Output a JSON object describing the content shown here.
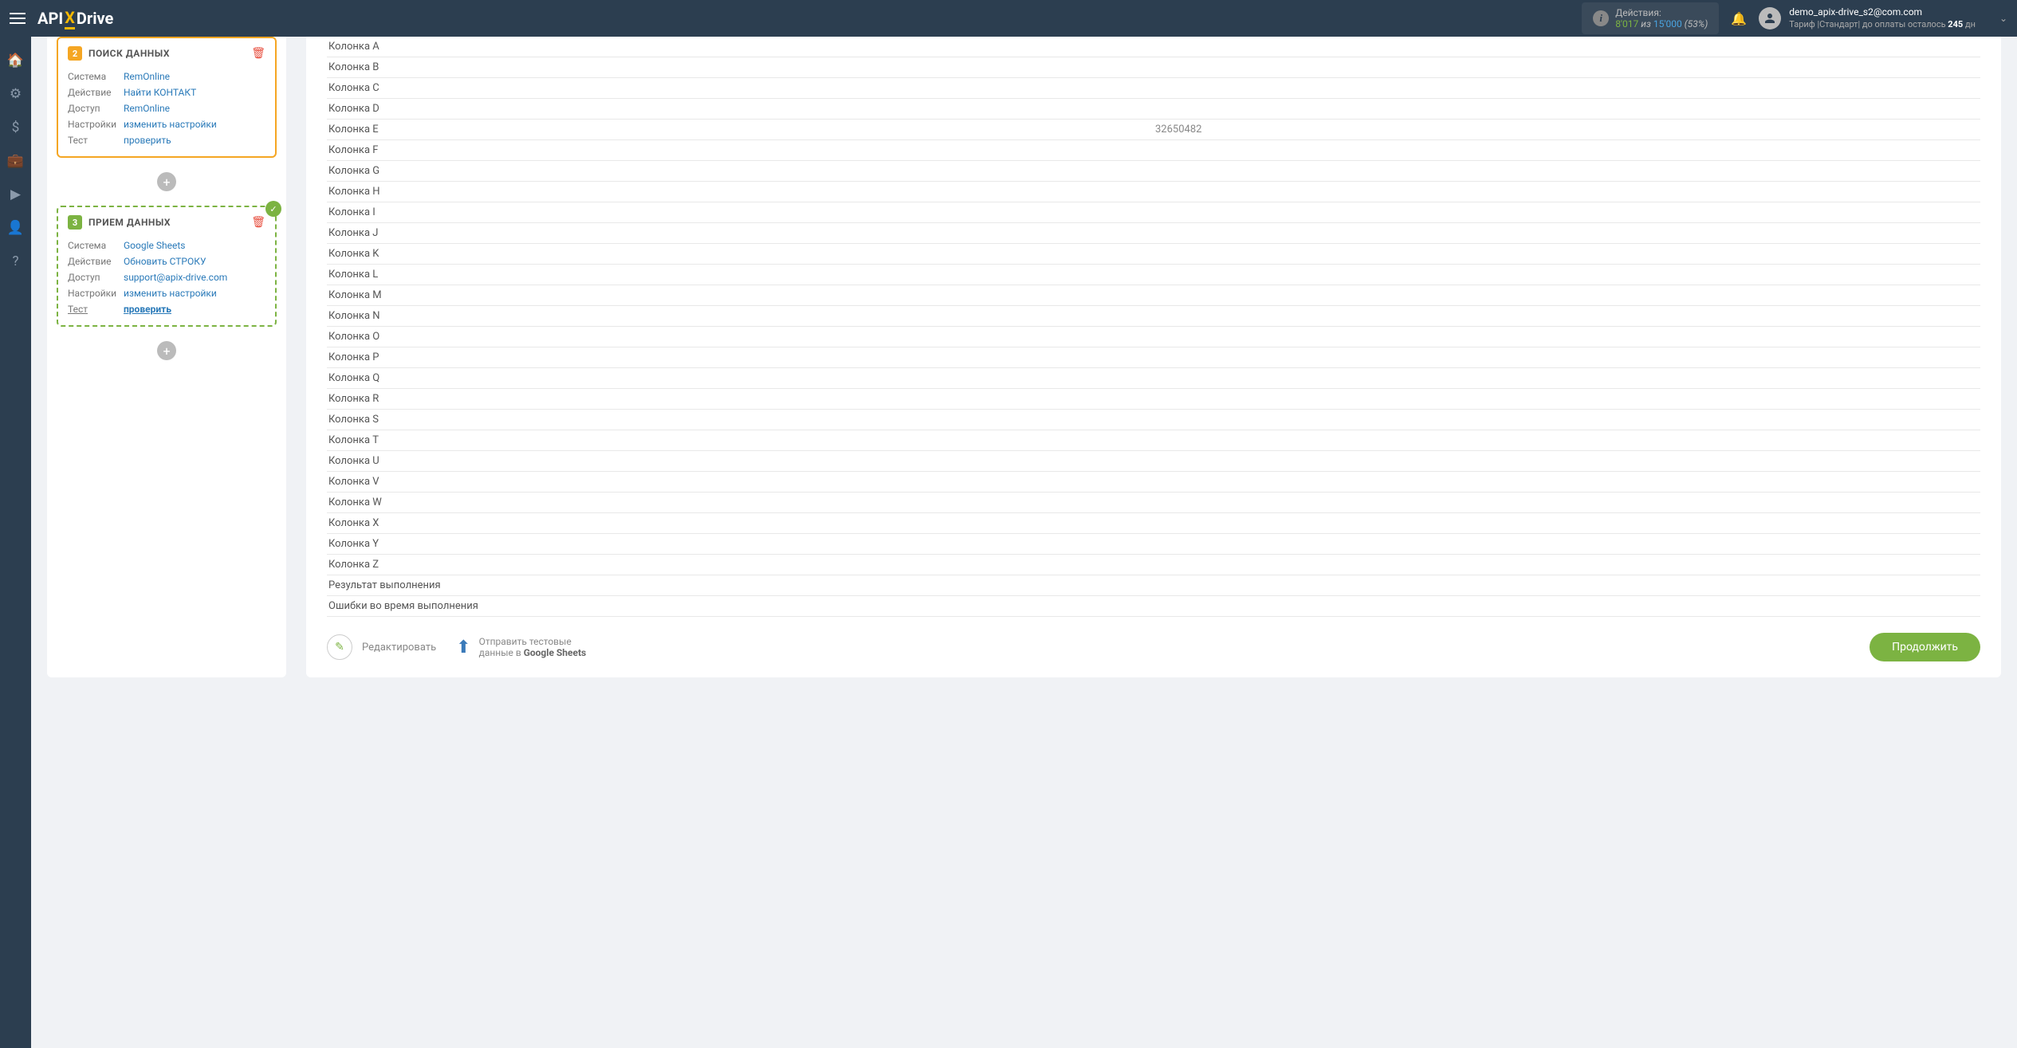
{
  "header": {
    "logo": {
      "api": "API",
      "x": "X",
      "drive": "Drive"
    },
    "actions": {
      "label": "Действия:",
      "num1": "8'017",
      "sep": "из",
      "num2": "15'000",
      "pct": "(53%)"
    },
    "user": {
      "email": "demo_apix-drive_s2@com.com",
      "tariff_prefix": "Тариф |Стандарт| до оплаты осталось ",
      "days": "245",
      "days_suffix": " дн"
    }
  },
  "cards": {
    "search": {
      "title": "ПОИСК ДАННЫХ",
      "num": "2",
      "rows": {
        "system_l": "Система",
        "system_v": "RemOnline",
        "action_l": "Действие",
        "action_v": "Найти КОНТАКТ",
        "access_l": "Доступ",
        "access_v": "RemOnline",
        "settings_l": "Настройки",
        "settings_v": "изменить настройки",
        "test_l": "Тест",
        "test_v": "проверить"
      }
    },
    "receive": {
      "title": "ПРИЕМ ДАННЫХ",
      "num": "3",
      "rows": {
        "system_l": "Система",
        "system_v": "Google Sheets",
        "action_l": "Действие",
        "action_v": "Обновить СТРОКУ",
        "access_l": "Доступ",
        "access_v": "support@apix-drive.com",
        "settings_l": "Настройки",
        "settings_v": "изменить настройки",
        "test_l": "Тест",
        "test_v": "проверить"
      }
    }
  },
  "table": {
    "rows": [
      {
        "k": "Колонка А",
        "v": ""
      },
      {
        "k": "Колонка B",
        "v": ""
      },
      {
        "k": "Колонка C",
        "v": ""
      },
      {
        "k": "Колонка D",
        "v": ""
      },
      {
        "k": "Колонка E",
        "v": "32650482"
      },
      {
        "k": "Колонка F",
        "v": ""
      },
      {
        "k": "Колонка G",
        "v": ""
      },
      {
        "k": "Колонка H",
        "v": ""
      },
      {
        "k": "Колонка I",
        "v": ""
      },
      {
        "k": "Колонка J",
        "v": ""
      },
      {
        "k": "Колонка K",
        "v": ""
      },
      {
        "k": "Колонка L",
        "v": ""
      },
      {
        "k": "Колонка M",
        "v": ""
      },
      {
        "k": "Колонка N",
        "v": ""
      },
      {
        "k": "Колонка O",
        "v": ""
      },
      {
        "k": "Колонка P",
        "v": ""
      },
      {
        "k": "Колонка Q",
        "v": ""
      },
      {
        "k": "Колонка R",
        "v": ""
      },
      {
        "k": "Колонка S",
        "v": ""
      },
      {
        "k": "Колонка T",
        "v": ""
      },
      {
        "k": "Колонка U",
        "v": ""
      },
      {
        "k": "Колонка V",
        "v": ""
      },
      {
        "k": "Колонка W",
        "v": ""
      },
      {
        "k": "Колонка X",
        "v": ""
      },
      {
        "k": "Колонка Y",
        "v": ""
      },
      {
        "k": "Колонка Z",
        "v": ""
      },
      {
        "k": "Результат выполнения",
        "v": ""
      },
      {
        "k": "Ошибки во время выполнения",
        "v": ""
      }
    ]
  },
  "bottom": {
    "edit": "Редактировать",
    "send_l1": "Отправить тестовые",
    "send_l2_pre": "данные в ",
    "send_l2_bold": "Google Sheets",
    "continue": "Продолжить"
  }
}
